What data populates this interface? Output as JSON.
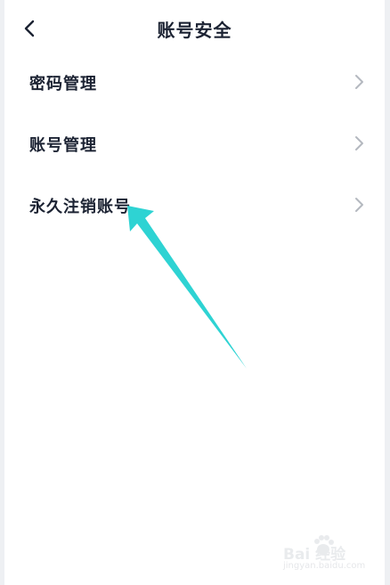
{
  "header": {
    "back_icon": "chevron-left-icon",
    "title": "账号安全"
  },
  "menu": {
    "items": [
      {
        "label": "密码管理",
        "icon": "chevron-right-icon"
      },
      {
        "label": "账号管理",
        "icon": "chevron-right-icon"
      },
      {
        "label": "永久注销账号",
        "icon": "chevron-right-icon"
      }
    ]
  },
  "annotation": {
    "arrow_color": "#2ed3d3"
  },
  "watermark": {
    "logo_text": "Bai 经验",
    "subtitle": "jingyan.baidu.com"
  },
  "colors": {
    "text": "#1c2333",
    "chevron": "#b4b8bf",
    "background": "#ffffff"
  }
}
